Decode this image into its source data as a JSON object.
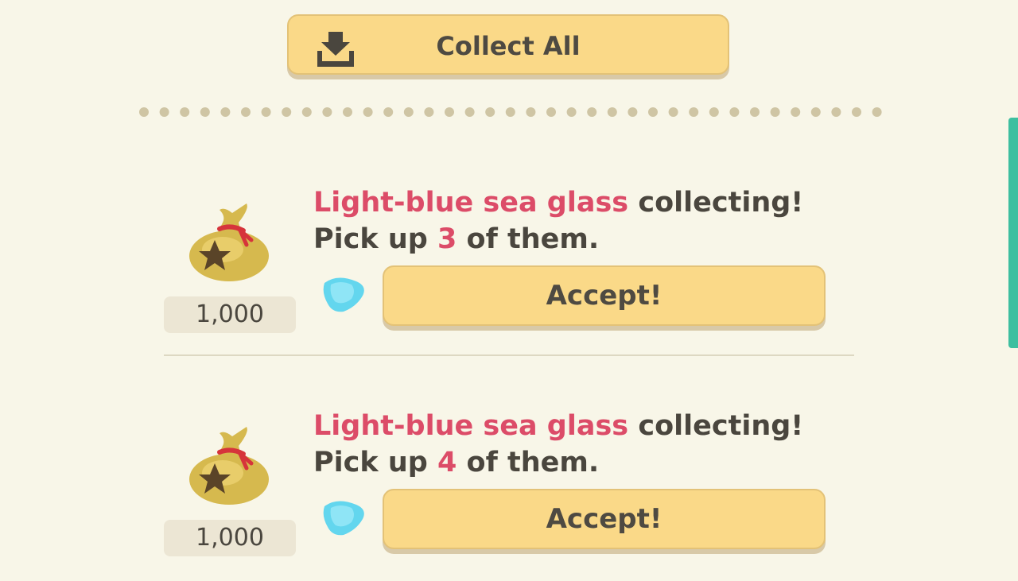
{
  "header": {
    "collect_all_label": "Collect All",
    "collect_icon": "download-tray-icon"
  },
  "quests": [
    {
      "reward": "1,000",
      "reward_icon": "bell-bag-icon",
      "item_icon": "light-blue-sea-glass-icon",
      "item_name": "Light-blue sea glass",
      "title_suffix": " collecting!",
      "line2_prefix": "Pick up ",
      "count": "3",
      "line2_suffix": " of them.",
      "button_label": "Accept!"
    },
    {
      "reward": "1,000",
      "reward_icon": "bell-bag-icon",
      "item_icon": "light-blue-sea-glass-icon",
      "item_name": "Light-blue sea glass",
      "title_suffix": " collecting!",
      "line2_prefix": "Pick up ",
      "count": "4",
      "line2_suffix": " of them.",
      "button_label": "Accept!"
    }
  ],
  "colors": {
    "background": "#f8f6e8",
    "button": "#fad988",
    "highlight": "#dc4c68",
    "scrollbar": "#3dbfa0"
  }
}
